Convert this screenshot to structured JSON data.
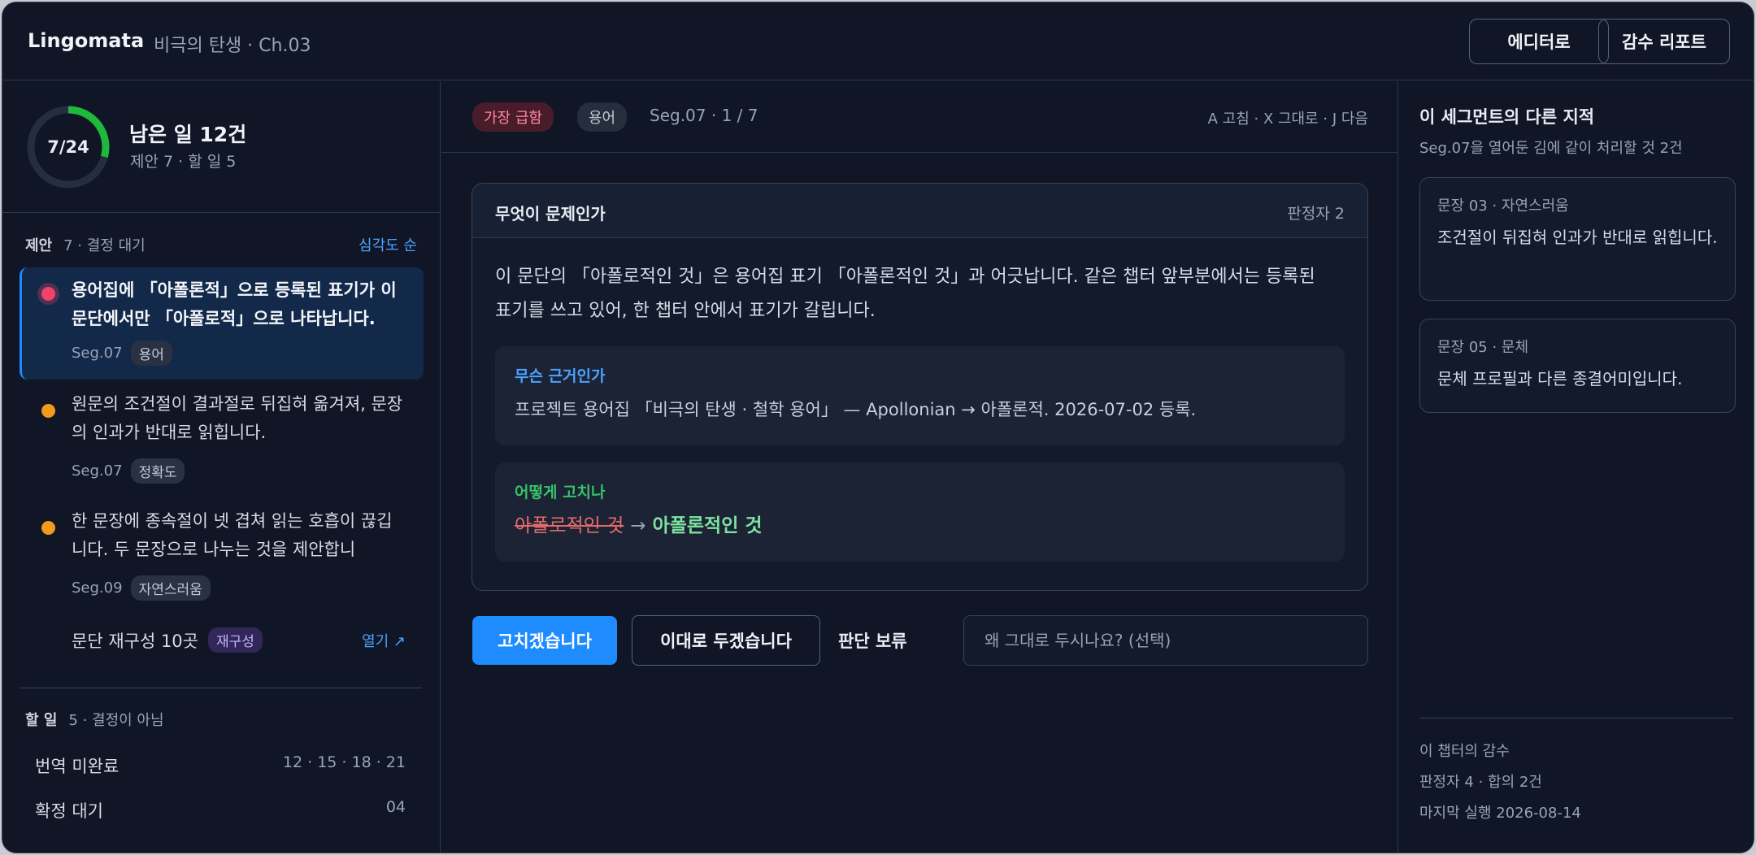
{
  "header": {
    "brand": "Lingomata",
    "doc_title": "비극의 탄생 · Ch.03",
    "editor_button": "에디터로",
    "report_button": "감수 리포트"
  },
  "progress": {
    "label": "7/24",
    "done": 7,
    "total": 24,
    "remaining": "남은 일 12건",
    "sub": "제안 7 · 할 일 5",
    "ring_color": "#1fb83a"
  },
  "suggestions": {
    "heading": "제안",
    "count": "7 · 결정 대기",
    "sort_label": "심각도 순",
    "items": [
      {
        "text": "용어집에 「아폴론적」으로 등록된 표기가 이 문단에서만 「아폴로적」으로 나타납니다.",
        "seg": "Seg.07",
        "tag": "용어",
        "severity": "critical"
      },
      {
        "text": "원문의 조건절이 결과절로 뒤집혀 옮겨져, 문장의 인과가 반대로 읽힙니다.",
        "seg": "Seg.07",
        "tag": "정확도",
        "severity": "warning"
      },
      {
        "text": "한 문장에 종속절이 넷 겹쳐 읽는 호흡이 끊깁니다. 두 문장으로 나누는 것을 제안합니",
        "seg": "Seg.09",
        "tag": "자연스러움",
        "severity": "warning"
      }
    ],
    "restructure_label": "문단 재구성 10곳",
    "restructure_tag": "재구성",
    "open_label": "열기 ↗"
  },
  "todo": {
    "heading": "할 일",
    "count": "5 · 결정이 아님",
    "rows": [
      {
        "label": "번역 미완료",
        "value": "12 · 15 · 18 · 21"
      },
      {
        "label": "확정 대기",
        "value": "04"
      }
    ]
  },
  "detail": {
    "urgency_tag": "가장 급함",
    "category_tag": "용어",
    "position": "Seg.07 · 1 / 7",
    "shortcuts": "A 고침 · X 그대로 · J 다음",
    "card_title": "무엇이 문제인가",
    "judges": "판정자 2",
    "problem": "이 문단의 「아폴로적인 것」은 용어집 표기 「아폴론적인 것」과 어긋납니다. 같은 챕터 앞부분에서는 등록된 표기를 쓰고 있어, 한 챕터 안에서 표기가 갈립니다.",
    "evidence_label": "무슨 근거인가",
    "evidence_text": "프로젝트 용어집 「비극의 탄생 · 철학 용어」 — Apollonian → 아폴론적. 2026-07-02 등록.",
    "fix_label": "어떻게 고치나",
    "fix_old": "아폴로적인 것",
    "fix_arrow": "→",
    "fix_new": "아폴론적인 것"
  },
  "actions": {
    "fix": "고치겠습니다",
    "keep": "이대로 두겠습니다",
    "defer": "판단 보류",
    "reason_placeholder": "왜 그대로 두시나요? (선택)"
  },
  "related": {
    "title": "이 세그먼트의 다른 지적",
    "sub": "Seg.07을 열어둔 김에 같이 처리할 것 2건",
    "items": [
      {
        "meta": "문장 03 · 자연스러움",
        "text": "조건절이 뒤집혀 인과가 반대로 읽힙니다."
      },
      {
        "meta": "문장 05 · 문체",
        "text": "문체 프로필과 다른 종결어미입니다."
      }
    ]
  },
  "chapter_review": {
    "title": "이 챕터의 감수",
    "judges": "판정자 4 · 합의 2건",
    "last_run": "마지막 실행 2026-08-14"
  }
}
